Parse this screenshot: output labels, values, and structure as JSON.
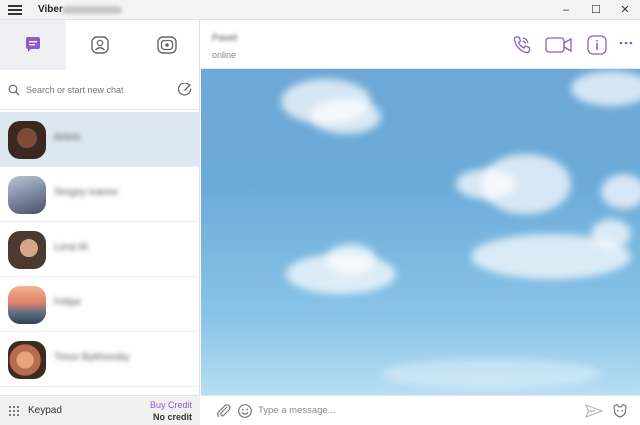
{
  "window": {
    "app_title": "Viber",
    "controls": {
      "minimize": "–",
      "maximize": "☐",
      "close": "✕"
    }
  },
  "tabs": [
    {
      "name": "chats",
      "icon": "chat-bubble-icon",
      "active": true
    },
    {
      "name": "contacts",
      "icon": "contact-icon",
      "active": false
    },
    {
      "name": "public",
      "icon": "public-chats-icon",
      "active": false
    }
  ],
  "search": {
    "placeholder": "Search or start new chat"
  },
  "chats": [
    {
      "name": "Artem"
    },
    {
      "name": "Sergey Ivanov"
    },
    {
      "name": "Lena M."
    },
    {
      "name": "Felipe"
    },
    {
      "name": "Timur Bykhovsky"
    }
  ],
  "bottom_left": {
    "keypad_label": "Keypad",
    "buy_credit": "Buy Credit",
    "no_credit": "No credit"
  },
  "conversation": {
    "contact_name": "Pavel",
    "status": "online"
  },
  "composer": {
    "placeholder": "Type a message..."
  },
  "colors": {
    "accent": "#8e5cc4",
    "selected_row": "#dde7ef",
    "sky": "#6ea8d6"
  }
}
